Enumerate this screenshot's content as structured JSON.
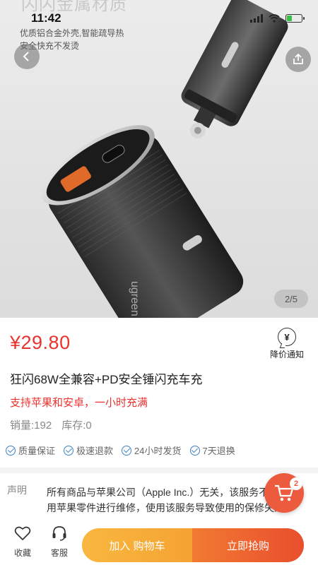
{
  "hero": {
    "overlay_title": "闪闪金属材质",
    "overlay_line1": "优质铝合金外壳,智能疏导热",
    "overlay_line2": "安全快充不发烫",
    "brand_text": "ugreen",
    "image_counter": "2/5"
  },
  "status_bar": {
    "time": "11:42"
  },
  "product": {
    "price": "¥29.80",
    "notify_label": "降价通知",
    "notify_icon_glyph": "¥",
    "title": "狂闪68W全兼容+PD安全锤闪充车充",
    "promo": "支持苹果和安卓，一小时充满",
    "sales": "销量:192",
    "stock": "库存:0"
  },
  "guarantees": [
    {
      "label": "质量保证",
      "icon": "check-circle-icon"
    },
    {
      "label": "极速退款",
      "icon": "check-circle-icon"
    },
    {
      "label": "24小时发货",
      "icon": "check-circle-icon"
    },
    {
      "label": "7天退换",
      "icon": "check-circle-icon"
    }
  ],
  "declaration": {
    "label": "声明",
    "text": "所有商品与苹果公司（Apple Inc.）无关，该服务不使用苹果零件进行维修，使用该服务导致使用的保修失效"
  },
  "floating_cart": {
    "badge": "2"
  },
  "bottom_bar": {
    "favorite_label": "收藏",
    "service_label": "客服",
    "add_to_cart_label": "加入 购物车",
    "buy_now_label": "立即抢购"
  },
  "colors": {
    "price_red": "#e8332f",
    "cart_orange": "#f5a333",
    "buy_orange": "#ea4e2e",
    "check_blue": "#3b82c4"
  }
}
